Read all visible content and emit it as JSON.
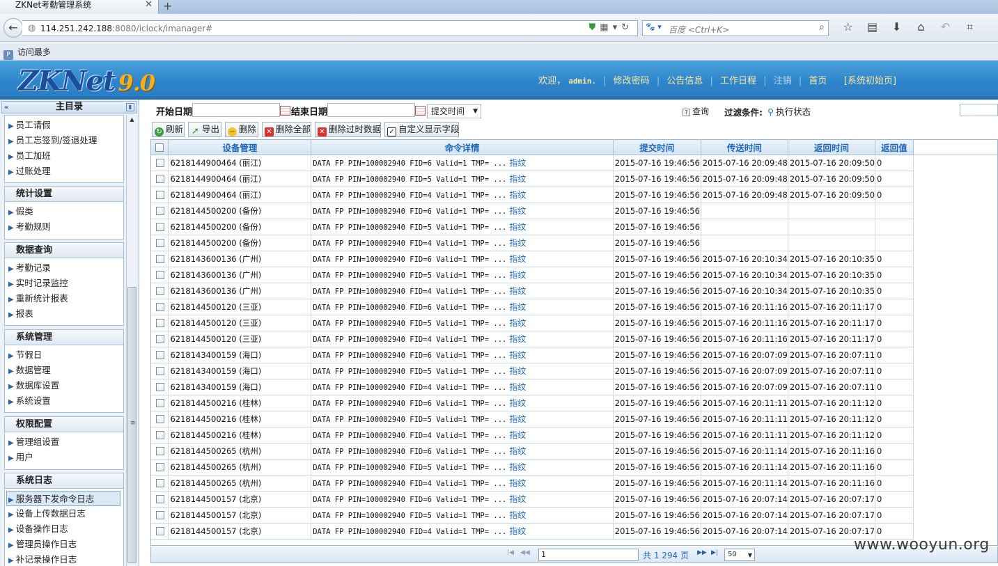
{
  "browser": {
    "tab_title": "ZKNet考勤管理系统",
    "tab_close": "✕",
    "new_tab": "+",
    "url_host": "114.251.242.188",
    "url_rest": ":8080/iclock/imanager#",
    "search_placeholder": "百度 <Ctrl+K>",
    "search_engine": "🐾 ▾",
    "bookmark": "访问最多"
  },
  "header": {
    "logo_main": "ZKNet",
    "logo_version": "9.0",
    "welcome": "欢迎，",
    "username": "admin.",
    "links": [
      "修改密码",
      "公告信息",
      "工作日程",
      "注销",
      "首页",
      "[系统初始页]"
    ]
  },
  "sidebar": {
    "title": "主目录",
    "groups": [
      {
        "title": "",
        "items": [
          "员工请假",
          "员工忘签到/签退处理",
          "员工加班",
          "过账处理"
        ]
      },
      {
        "title": "统计设置",
        "items": [
          "假类",
          "考勤规则"
        ]
      },
      {
        "title": "数据查询",
        "items": [
          "考勤记录",
          "实时记录监控",
          "重新统计报表",
          "报表"
        ]
      },
      {
        "title": "系统管理",
        "items": [
          "节假日",
          "数据管理",
          "数据库设置",
          "系统设置"
        ]
      },
      {
        "title": "权限配置",
        "items": [
          "管理组设置",
          "用户"
        ]
      },
      {
        "title": "系统日志",
        "items": [
          "服务器下发命令日志",
          "设备上传数据日志",
          "设备操作日志",
          "管理员操作日志",
          "补记录操作日志"
        ]
      }
    ],
    "active_item": "服务器下发命令日志"
  },
  "filters": {
    "start_label": "开始日期",
    "end_label": "结束日期",
    "time_select": "提交时间",
    "query": "查询",
    "filter_label": "过滤条件:",
    "exec_status": "执行状态"
  },
  "actions": [
    "刷新",
    "导出",
    "删除",
    "删除全部",
    "删除过时数据",
    "自定义显示字段"
  ],
  "table": {
    "columns": [
      "设备管理",
      "命令详情",
      "提交时间",
      "传送时间",
      "返回时间",
      "返回值"
    ],
    "link_text": "指纹",
    "rows": [
      [
        "6218144900464 (丽江)",
        "DATA FP PIN=100002940 FID=6 Valid=1 TMP= ...",
        "2015-07-16 19:46:56",
        "2015-07-16 20:09:48",
        "2015-07-16 20:09:50",
        "0"
      ],
      [
        "6218144900464 (丽江)",
        "DATA FP PIN=100002940 FID=5 Valid=1 TMP= ...",
        "2015-07-16 19:46:56",
        "2015-07-16 20:09:48",
        "2015-07-16 20:09:50",
        "0"
      ],
      [
        "6218144900464 (丽江)",
        "DATA FP PIN=100002940 FID=4 Valid=1 TMP= ...",
        "2015-07-16 19:46:56",
        "2015-07-16 20:09:48",
        "2015-07-16 20:09:50",
        "0"
      ],
      [
        "6218144500200 (备份)",
        "DATA FP PIN=100002940 FID=6 Valid=1 TMP= ...",
        "2015-07-16 19:46:56",
        "",
        "",
        ""
      ],
      [
        "6218144500200 (备份)",
        "DATA FP PIN=100002940 FID=5 Valid=1 TMP= ...",
        "2015-07-16 19:46:56",
        "",
        "",
        ""
      ],
      [
        "6218144500200 (备份)",
        "DATA FP PIN=100002940 FID=4 Valid=1 TMP= ...",
        "2015-07-16 19:46:56",
        "",
        "",
        ""
      ],
      [
        "6218143600136 (广州)",
        "DATA FP PIN=100002940 FID=6 Valid=1 TMP= ...",
        "2015-07-16 19:46:56",
        "2015-07-16 20:10:34",
        "2015-07-16 20:10:35",
        "0"
      ],
      [
        "6218143600136 (广州)",
        "DATA FP PIN=100002940 FID=5 Valid=1 TMP= ...",
        "2015-07-16 19:46:56",
        "2015-07-16 20:10:34",
        "2015-07-16 20:10:35",
        "0"
      ],
      [
        "6218143600136 (广州)",
        "DATA FP PIN=100002940 FID=4 Valid=1 TMP= ...",
        "2015-07-16 19:46:56",
        "2015-07-16 20:10:34",
        "2015-07-16 20:10:35",
        "0"
      ],
      [
        "6218144500120 (三亚)",
        "DATA FP PIN=100002940 FID=6 Valid=1 TMP= ...",
        "2015-07-16 19:46:56",
        "2015-07-16 20:11:16",
        "2015-07-16 20:11:17",
        "0"
      ],
      [
        "6218144500120 (三亚)",
        "DATA FP PIN=100002940 FID=5 Valid=1 TMP= ...",
        "2015-07-16 19:46:56",
        "2015-07-16 20:11:16",
        "2015-07-16 20:11:17",
        "0"
      ],
      [
        "6218144500120 (三亚)",
        "DATA FP PIN=100002940 FID=4 Valid=1 TMP= ...",
        "2015-07-16 19:46:56",
        "2015-07-16 20:11:16",
        "2015-07-16 20:11:17",
        "0"
      ],
      [
        "6218143400159 (海口)",
        "DATA FP PIN=100002940 FID=6 Valid=1 TMP= ...",
        "2015-07-16 19:46:56",
        "2015-07-16 20:07:09",
        "2015-07-16 20:07:11",
        "0"
      ],
      [
        "6218143400159 (海口)",
        "DATA FP PIN=100002940 FID=5 Valid=1 TMP= ...",
        "2015-07-16 19:46:56",
        "2015-07-16 20:07:09",
        "2015-07-16 20:07:11",
        "0"
      ],
      [
        "6218143400159 (海口)",
        "DATA FP PIN=100002940 FID=4 Valid=1 TMP= ...",
        "2015-07-16 19:46:56",
        "2015-07-16 20:07:09",
        "2015-07-16 20:07:11",
        "0"
      ],
      [
        "6218144500216 (桂林)",
        "DATA FP PIN=100002940 FID=6 Valid=1 TMP= ...",
        "2015-07-16 19:46:56",
        "2015-07-16 20:11:11",
        "2015-07-16 20:11:12",
        "0"
      ],
      [
        "6218144500216 (桂林)",
        "DATA FP PIN=100002940 FID=5 Valid=1 TMP= ...",
        "2015-07-16 19:46:56",
        "2015-07-16 20:11:11",
        "2015-07-16 20:11:12",
        "0"
      ],
      [
        "6218144500216 (桂林)",
        "DATA FP PIN=100002940 FID=4 Valid=1 TMP= ...",
        "2015-07-16 19:46:56",
        "2015-07-16 20:11:11",
        "2015-07-16 20:11:12",
        "0"
      ],
      [
        "6218144500265 (杭州)",
        "DATA FP PIN=100002940 FID=6 Valid=1 TMP= ...",
        "2015-07-16 19:46:56",
        "2015-07-16 20:11:14",
        "2015-07-16 20:11:16",
        "0"
      ],
      [
        "6218144500265 (杭州)",
        "DATA FP PIN=100002940 FID=5 Valid=1 TMP= ...",
        "2015-07-16 19:46:56",
        "2015-07-16 20:11:14",
        "2015-07-16 20:11:16",
        "0"
      ],
      [
        "6218144500265 (杭州)",
        "DATA FP PIN=100002940 FID=4 Valid=1 TMP= ...",
        "2015-07-16 19:46:56",
        "2015-07-16 20:11:14",
        "2015-07-16 20:11:16",
        "0"
      ],
      [
        "6218144500157 (北京)",
        "DATA FP PIN=100002940 FID=6 Valid=1 TMP= ...",
        "2015-07-16 19:46:56",
        "2015-07-16 20:07:14",
        "2015-07-16 20:07:17",
        "0"
      ],
      [
        "6218144500157 (北京)",
        "DATA FP PIN=100002940 FID=5 Valid=1 TMP= ...",
        "2015-07-16 19:46:56",
        "2015-07-16 20:07:14",
        "2015-07-16 20:07:17",
        "0"
      ],
      [
        "6218144500157 (北京)",
        "DATA FP PIN=100002940 FID=4 Valid=1 TMP= ...",
        "2015-07-16 19:46:56",
        "2015-07-16 20:07:14",
        "2015-07-16 20:07:17",
        "0"
      ]
    ]
  },
  "pager": {
    "page_value": "1",
    "summary": "共 1 294 页",
    "page_size": "50"
  },
  "watermark": "www.wooyun.org"
}
